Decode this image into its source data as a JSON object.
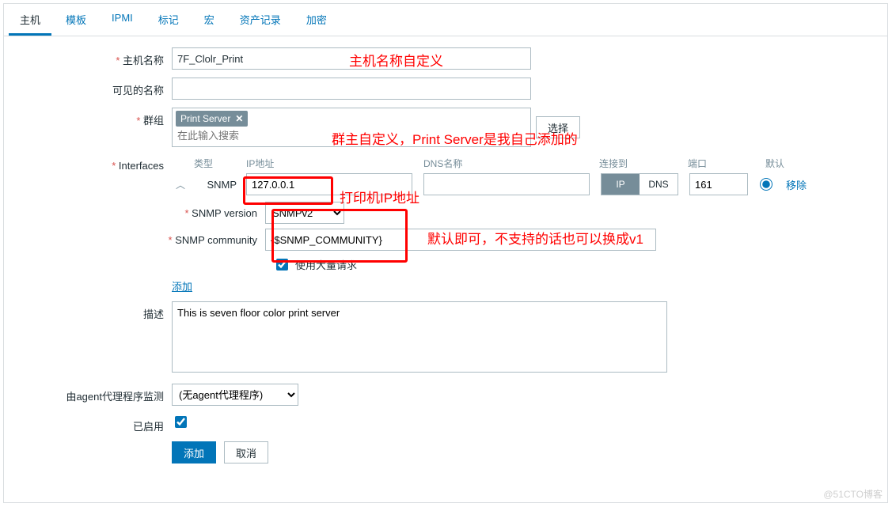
{
  "tabs": [
    "主机",
    "模板",
    "IPMI",
    "标记",
    "宏",
    "资产记录",
    "加密"
  ],
  "labels": {
    "host_name": "主机名称",
    "visible_name": "可见的名称",
    "groups": "群组",
    "groups_select": "选择",
    "groups_placeholder": "在此输入搜索",
    "interfaces": "Interfaces",
    "col_type": "类型",
    "col_ip": "IP地址",
    "col_dns": "DNS名称",
    "col_conn": "连接到",
    "col_port": "端口",
    "col_default": "默认",
    "if_type": "SNMP",
    "seg_ip": "IP",
    "seg_dns": "DNS",
    "remove": "移除",
    "snmp_version": "SNMP version",
    "snmp_community": "SNMP community",
    "bulk": "使用大量请求",
    "add_if": "添加",
    "description": "描述",
    "agent_monitor": "由agent代理程序监测",
    "enabled": "已启用",
    "btn_add": "添加",
    "btn_cancel": "取消"
  },
  "values": {
    "host_name": "7F_Clolr_Print",
    "visible_name": "",
    "group_chip": "Print Server",
    "ip": "127.0.0.1",
    "dns": "",
    "port": "161",
    "snmp_version": "SNMPv2",
    "snmp_community": "{$SNMP_COMMUNITY}",
    "bulk_checked": true,
    "description": "This is seven floor color print server",
    "agent_select": "(无agent代理程序)",
    "enabled_checked": true,
    "default_radio": true
  },
  "annotations": {
    "a1": "主机名称自定义",
    "a2": "群主自定义，Print Server是我自己添加的",
    "a3": "打印机IP地址",
    "a4": "默认即可，不支持的话也可以换成v1"
  },
  "watermark": "@51CTO博客"
}
